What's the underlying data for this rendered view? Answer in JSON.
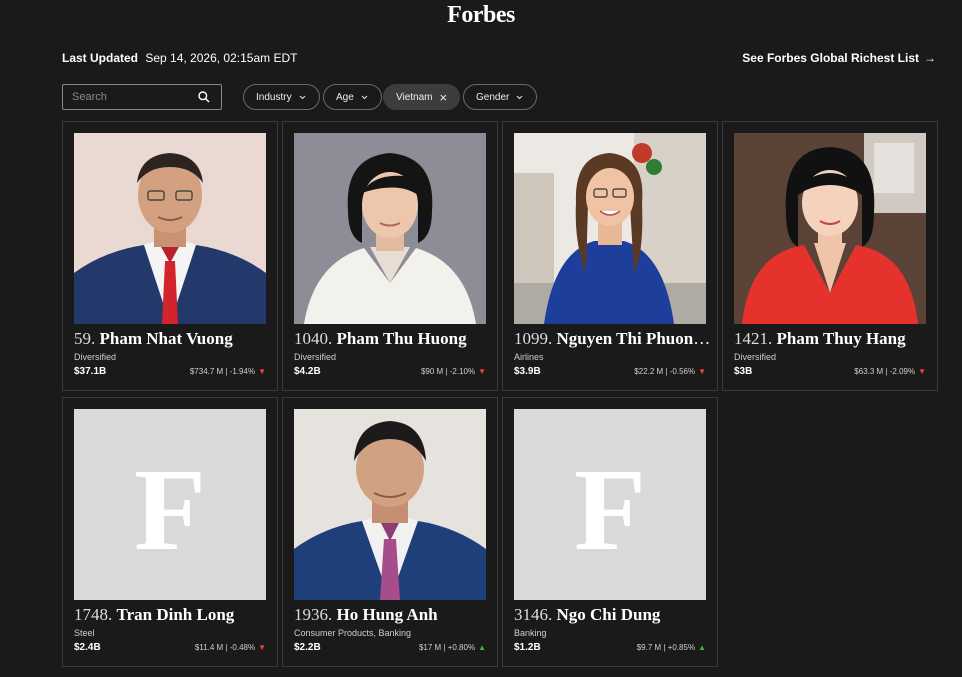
{
  "brand": "Forbes",
  "last_updated": {
    "label": "Last Updated",
    "value": "Sep 14, 2026, 02:15am EDT"
  },
  "global_link": {
    "label": "See Forbes Global Richest List",
    "arrow": "→"
  },
  "search": {
    "placeholder": "Search",
    "value": ""
  },
  "filters": [
    {
      "label": "Industry",
      "active": false
    },
    {
      "label": "Age",
      "active": false
    },
    {
      "label": "Vietnam",
      "active": true,
      "remove": "×"
    },
    {
      "label": "Gender",
      "active": false
    }
  ],
  "colors": {
    "bg": "#1a1a1a",
    "down": "#e9463f",
    "up": "#39b54a",
    "placeholder_bg": "#d9d9d9"
  },
  "placeholder_letter": "F",
  "people": [
    {
      "rank": "59.",
      "name": "Pham Nhat Vuong",
      "industry": "Diversified",
      "worth": "$37.1B",
      "change": "$734.7 M | -1.94%",
      "dir": "down",
      "photo": "man-red-tie"
    },
    {
      "rank": "1040.",
      "name": "Pham Thu Huong",
      "industry": "Diversified",
      "worth": "$4.2B",
      "change": "$90 M | -2.10%",
      "dir": "down",
      "photo": "woman-white-blazer"
    },
    {
      "rank": "1099.",
      "name": "Nguyen Thi Phuong Thao",
      "industry": "Airlines",
      "worth": "$3.9B",
      "change": "$22.2 M | -0.56%",
      "dir": "down",
      "photo": "woman-blue-dress"
    },
    {
      "rank": "1421.",
      "name": "Pham Thuy Hang",
      "industry": "Diversified",
      "worth": "$3B",
      "change": "$63.3 M | -2.09%",
      "dir": "down",
      "photo": "woman-red-dress"
    },
    {
      "rank": "1748.",
      "name": "Tran Dinh Long",
      "industry": "Steel",
      "worth": "$2.4B",
      "change": "$11.4 M | -0.48%",
      "dir": "down",
      "photo": "placeholder"
    },
    {
      "rank": "1936.",
      "name": "Ho Hung Anh",
      "industry": "Consumer Products, Banking",
      "worth": "$2.2B",
      "change": "$17 M | +0.80%",
      "dir": "up",
      "photo": "man-pink-tie"
    },
    {
      "rank": "3146.",
      "name": "Ngo Chi Dung",
      "industry": "Banking",
      "worth": "$1.2B",
      "change": "$9.7 M | +0.85%",
      "dir": "up",
      "photo": "placeholder"
    }
  ]
}
